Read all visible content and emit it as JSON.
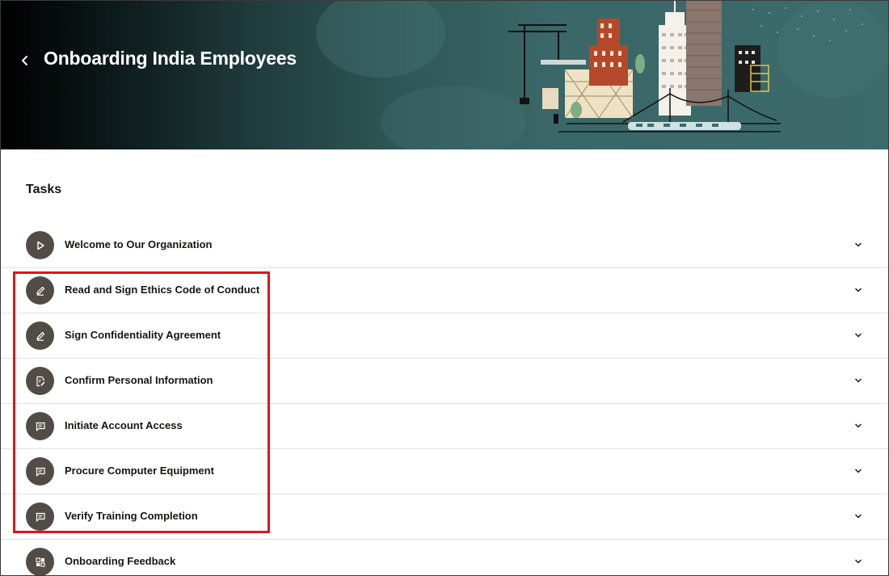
{
  "header": {
    "title": "Onboarding India Employees",
    "back_icon": "chevron-left-icon"
  },
  "tasks_section": {
    "title": "Tasks",
    "items": [
      {
        "label": "Welcome to Our Organization",
        "icon": "play-icon"
      },
      {
        "label": "Read and Sign Ethics Code of Conduct",
        "icon": "pencil-icon"
      },
      {
        "label": "Sign Confidentiality Agreement",
        "icon": "pencil-icon"
      },
      {
        "label": "Confirm Personal Information",
        "icon": "document-edit-icon"
      },
      {
        "label": "Initiate Account Access",
        "icon": "chat-bubble-icon"
      },
      {
        "label": "Procure Computer Equipment",
        "icon": "chat-bubble-icon"
      },
      {
        "label": "Verify Training Completion",
        "icon": "chat-bubble-icon"
      },
      {
        "label": "Onboarding Feedback",
        "icon": "questionnaire-icon"
      }
    ]
  },
  "colors": {
    "banner_dark": "#000000",
    "banner_teal": "#3c6b6b",
    "icon_circle": "#514c46",
    "highlight_border": "#e0141e"
  }
}
